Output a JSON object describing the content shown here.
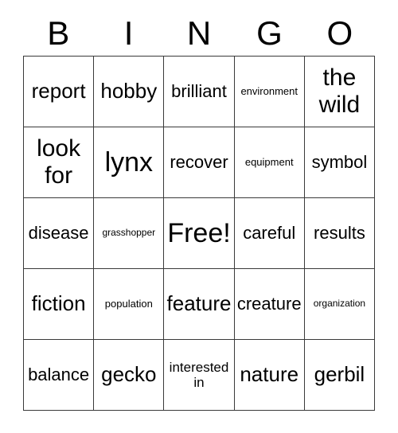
{
  "card": {
    "title_letters": [
      "B",
      "I",
      "N",
      "G",
      "O"
    ],
    "rows": [
      [
        {
          "text": "report",
          "size": "lg"
        },
        {
          "text": "hobby",
          "size": "lg"
        },
        {
          "text": "brilliant",
          "size": "md"
        },
        {
          "text": "environment",
          "size": "xs"
        },
        {
          "text": "the wild",
          "size": "xl"
        }
      ],
      [
        {
          "text": "look for",
          "size": "xl"
        },
        {
          "text": "lynx",
          "size": "xxl"
        },
        {
          "text": "recover",
          "size": "md"
        },
        {
          "text": "equipment",
          "size": "xs"
        },
        {
          "text": "symbol",
          "size": "md"
        }
      ],
      [
        {
          "text": "disease",
          "size": "md"
        },
        {
          "text": "grasshopper",
          "size": "xxs"
        },
        {
          "text": "Free!",
          "size": "xxl"
        },
        {
          "text": "careful",
          "size": "md"
        },
        {
          "text": "results",
          "size": "md"
        }
      ],
      [
        {
          "text": "fiction",
          "size": "lg"
        },
        {
          "text": "population",
          "size": "xs"
        },
        {
          "text": "feature",
          "size": "lg"
        },
        {
          "text": "creature",
          "size": "md"
        },
        {
          "text": "organization",
          "size": "xxs"
        }
      ],
      [
        {
          "text": "balance",
          "size": "md"
        },
        {
          "text": "gecko",
          "size": "lg"
        },
        {
          "text": "interested in",
          "size": "sm"
        },
        {
          "text": "nature",
          "size": "lg"
        },
        {
          "text": "gerbil",
          "size": "lg"
        }
      ]
    ],
    "colors": {
      "border": "#3a3a3a",
      "text": "#000000",
      "background": "#ffffff"
    }
  }
}
